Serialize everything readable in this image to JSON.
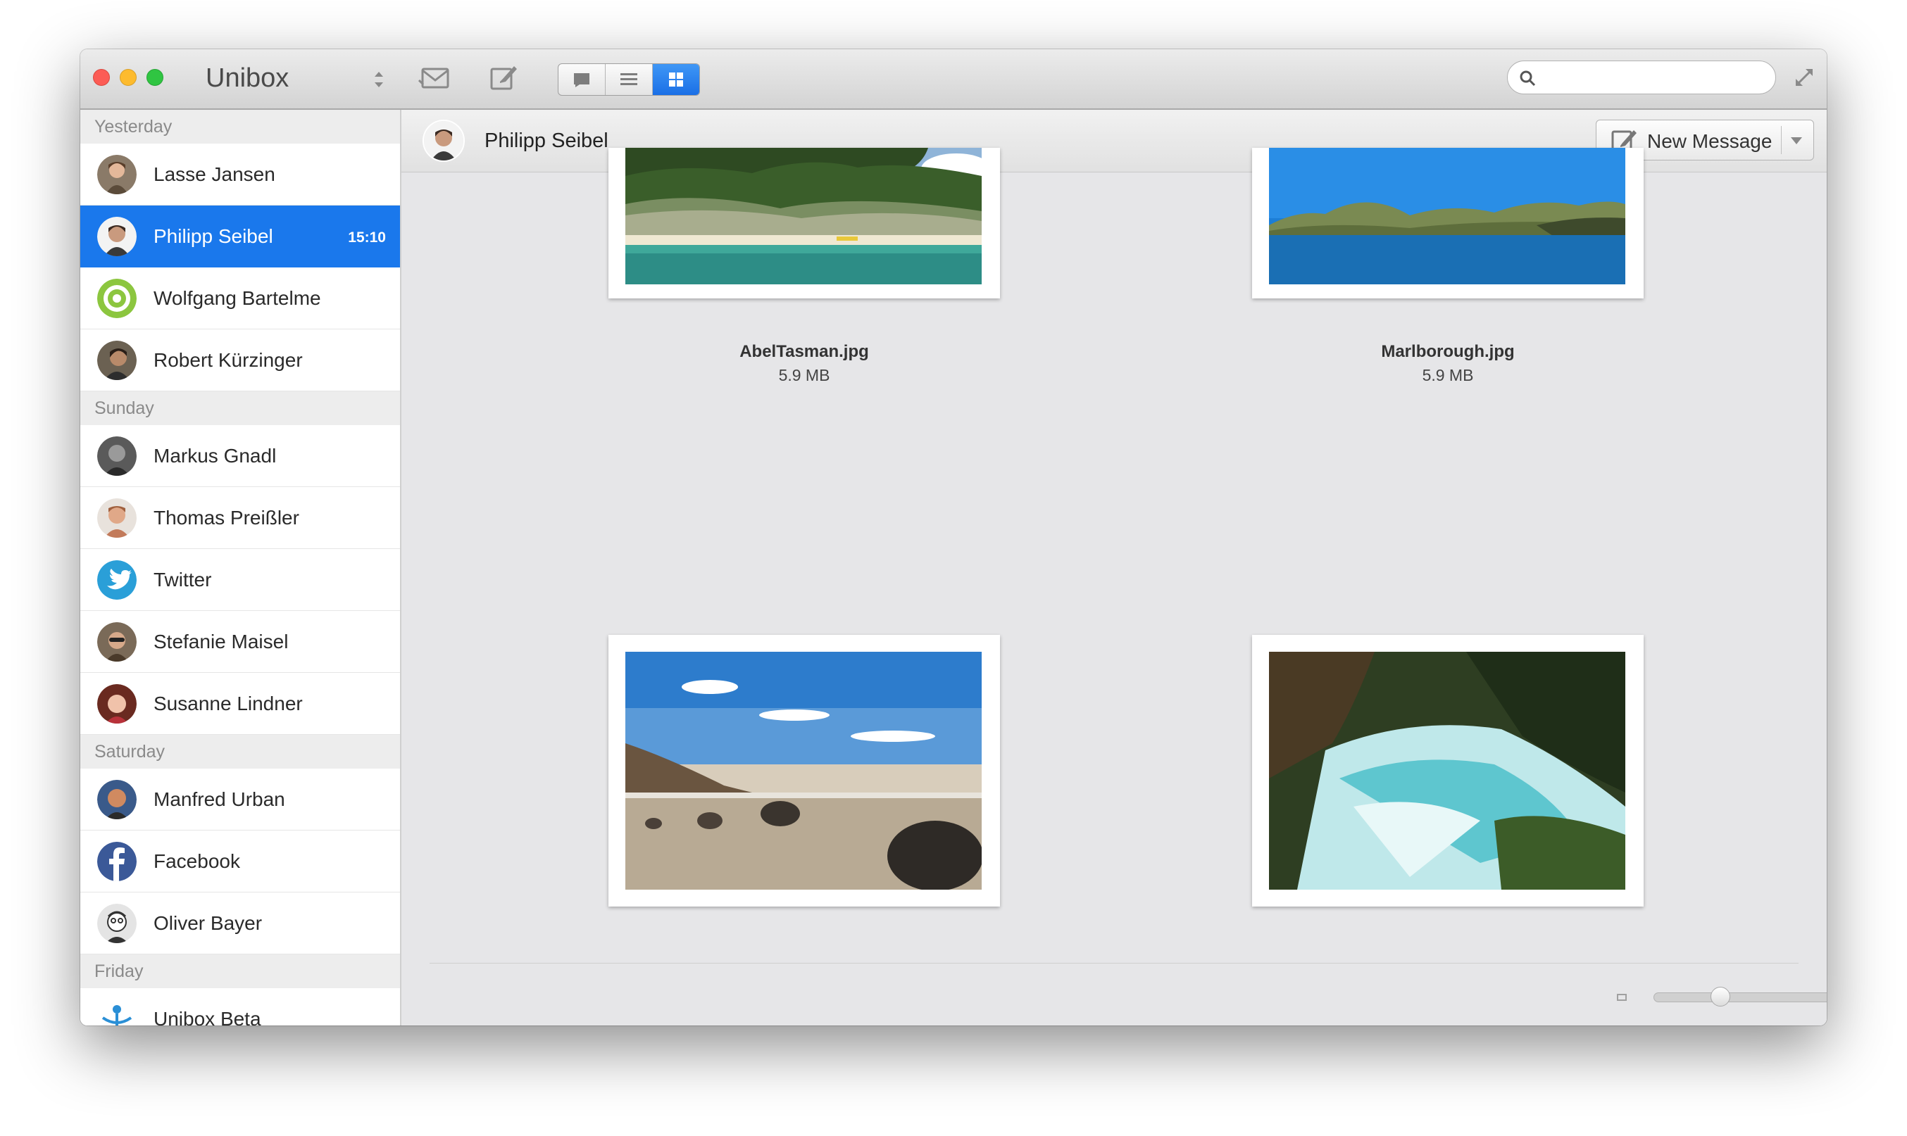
{
  "window": {
    "app_title": "Unibox",
    "accent": "#1a78ec"
  },
  "toolbar": {
    "search_value": "",
    "search_placeholder": "",
    "view_modes": [
      "conversation-view",
      "list-view",
      "grid-view"
    ],
    "active_view": "grid-view"
  },
  "sidebar": {
    "sections": [
      {
        "label": "Yesterday",
        "contacts": [
          {
            "name": "Lasse Jansen",
            "time": ""
          },
          {
            "name": "Philipp Seibel",
            "time": "15:10",
            "selected": true
          },
          {
            "name": "Wolfgang Bartelme",
            "time": ""
          },
          {
            "name": "Robert Kürzinger",
            "time": ""
          }
        ]
      },
      {
        "label": "Sunday",
        "contacts": [
          {
            "name": "Markus Gnadl",
            "time": ""
          },
          {
            "name": "Thomas Preißler",
            "time": ""
          },
          {
            "name": "Twitter",
            "time": ""
          },
          {
            "name": "Stefanie Maisel",
            "time": ""
          },
          {
            "name": "Susanne Lindner",
            "time": ""
          }
        ]
      },
      {
        "label": "Saturday",
        "contacts": [
          {
            "name": "Manfred Urban",
            "time": ""
          },
          {
            "name": "Facebook",
            "time": ""
          },
          {
            "name": "Oliver Bayer",
            "time": ""
          }
        ]
      },
      {
        "label": "Friday",
        "contacts": [
          {
            "name": "Unibox Beta",
            "time": ""
          }
        ]
      }
    ]
  },
  "conversation": {
    "contact_name": "Philipp Seibel",
    "new_message_label": "New Message"
  },
  "attachments": [
    {
      "name": "AbelTasman.jpg",
      "size": "5.9 MB"
    },
    {
      "name": "Marlborough.jpg",
      "size": "5.9 MB"
    },
    {
      "name": "",
      "size": ""
    },
    {
      "name": "",
      "size": ""
    }
  ],
  "zoom": {
    "level": 0.32
  }
}
